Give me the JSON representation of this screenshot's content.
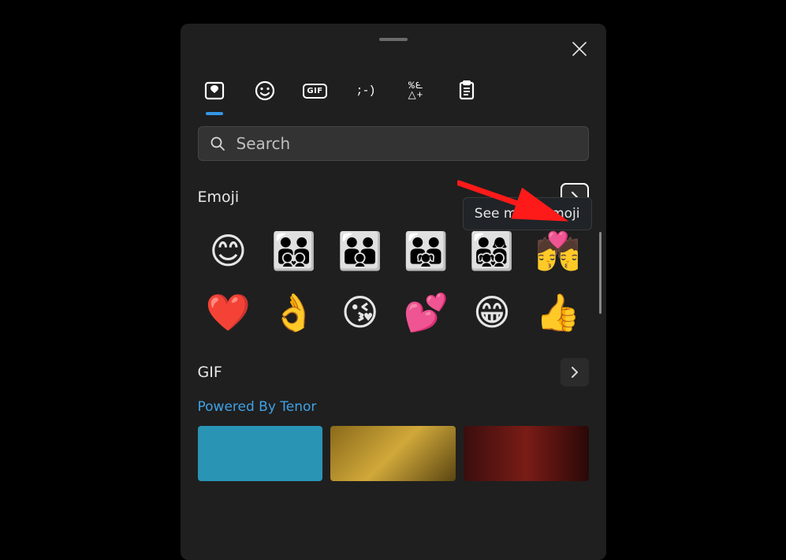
{
  "search": {
    "placeholder": "Search"
  },
  "tabs": {
    "recent_label": "Recent",
    "emoji_label": "Emoji",
    "gif_label": "GIF",
    "kaomoji_label": "Kaomoji",
    "symbols_label": "Symbols",
    "clipboard_label": "Clipboard"
  },
  "sections": {
    "emoji": {
      "title": "Emoji",
      "more_tooltip": "See more Emoji"
    },
    "gif": {
      "title": "GIF",
      "powered": "Powered By Tenor"
    }
  },
  "emoji_items": [
    "😊",
    "👨‍👨‍👦‍👦",
    "👨‍👨‍👦",
    "👨‍👨‍👧",
    "👨‍👩‍👧‍👦",
    "💏",
    "❤️",
    "👌",
    "😘",
    "💕",
    "😁",
    "👍"
  ],
  "gif_thumbs": [
    {
      "bg": "#2a94b5"
    },
    {
      "bg": "linear-gradient(135deg,#8a6a1a,#d0a83a,#5a4512)"
    },
    {
      "bg": "linear-gradient(90deg,#3a0e0e,#7a1c16,#2a0808)"
    }
  ],
  "colors": {
    "accent": "#3397e7",
    "panel": "#1f1f1f",
    "field": "#333333"
  }
}
